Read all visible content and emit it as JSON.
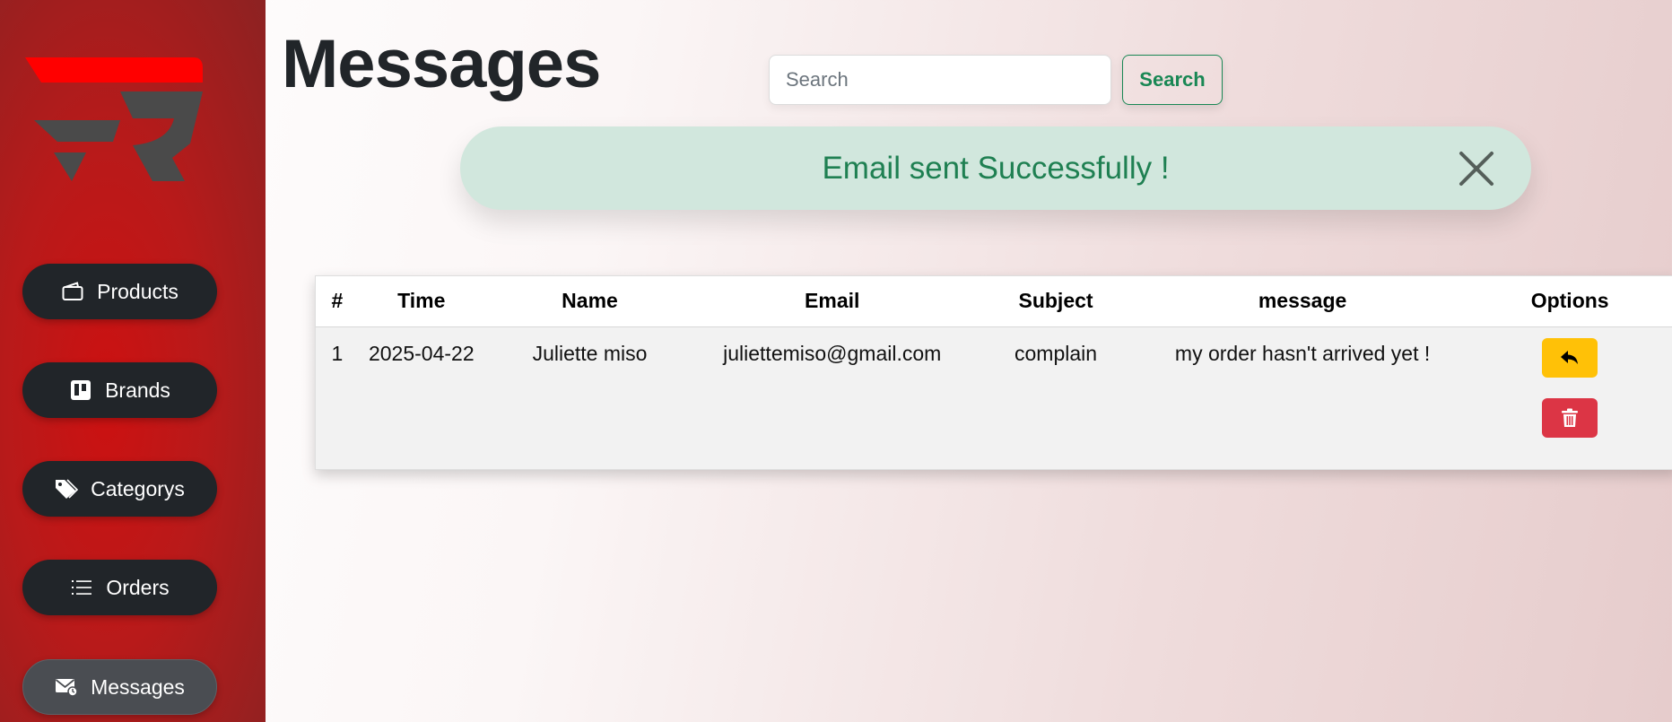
{
  "page": {
    "title": "Messages"
  },
  "search": {
    "placeholder": "Search",
    "value": "",
    "button_label": "Search"
  },
  "sidebar": {
    "items": [
      {
        "label": "Products",
        "icon": "wallet-icon"
      },
      {
        "label": "Brands",
        "icon": "board-icon"
      },
      {
        "label": "Categorys",
        "icon": "tag-icon"
      },
      {
        "label": "Orders",
        "icon": "list-icon"
      },
      {
        "label": "Messages",
        "icon": "envelope-icon",
        "active": true
      }
    ]
  },
  "alert": {
    "text": "Email sent Successfully !"
  },
  "table": {
    "headers": [
      "#",
      "Time",
      "Name",
      "Email",
      "Subject",
      "message",
      "Options"
    ],
    "rows": [
      {
        "id": "1",
        "time": "2025-04-22",
        "name": "Juliette miso",
        "email": "juliettemiso@gmail.com",
        "subject": "complain",
        "message": "my order hasn't arrived yet !"
      }
    ]
  },
  "colors": {
    "sidebar": "#cc1111",
    "nav_button": "#212529",
    "alert_bg": "#d1e7dd",
    "alert_text": "#1f8052",
    "reply": "#ffc107",
    "delete": "#dc3545"
  }
}
